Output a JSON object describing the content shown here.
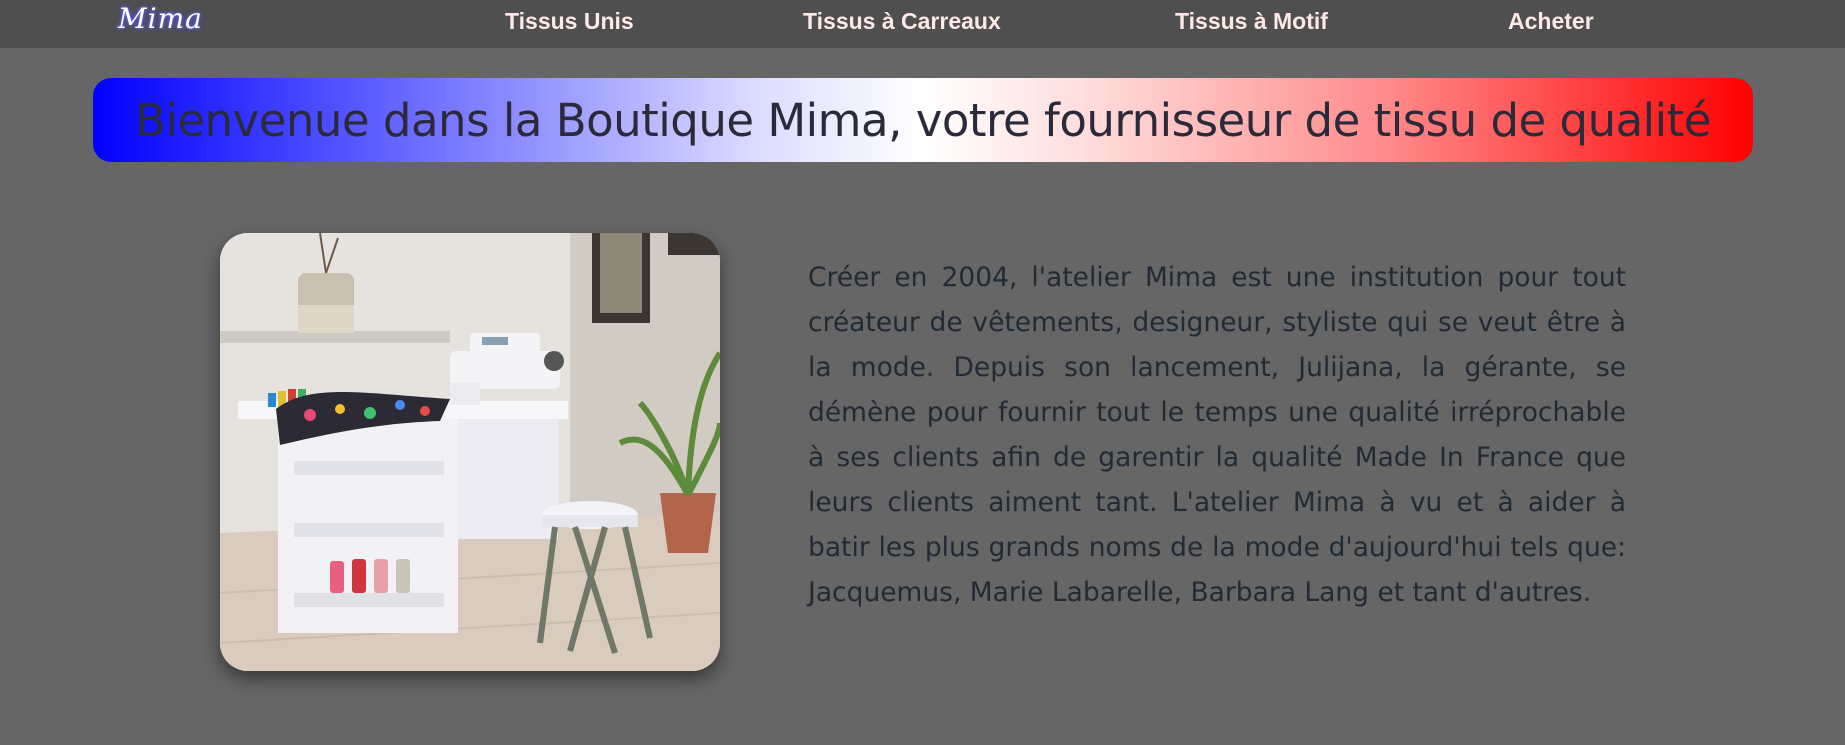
{
  "nav": {
    "logo": "Mima",
    "links": [
      {
        "label": "Tissus Unis"
      },
      {
        "label": "Tissus à Carreaux"
      },
      {
        "label": "Tissus à Motif"
      },
      {
        "label": "Acheter"
      }
    ]
  },
  "banner": {
    "title": "Bienvenue dans la Boutique Mima, votre fournisseur de tissu de qualité"
  },
  "about": {
    "text": "Créer en 2004, l'atelier Mima est une institution pour tout créateur de vêtements, designeur, styliste qui se veut être à la mode. Depuis son lancement, Julijana, la gérante, se démène pour fournir tout le temps une qualité irréprochable à ses clients afin de garentir la qualité Made In France que leurs clients aiment tant. L'atelier Mima à vu et à aider à batir les plus grands noms de la mode d'aujourd'hui tels que: Jacquemus, Marie Labarelle, Barbara Lang et tant d'autres."
  },
  "colors": {
    "page_background": "#666666",
    "navbar_background": "#4f4f4f",
    "nav_link": "#ffe8e8",
    "banner_left": "#0000ff",
    "banner_right": "#ff0000"
  }
}
